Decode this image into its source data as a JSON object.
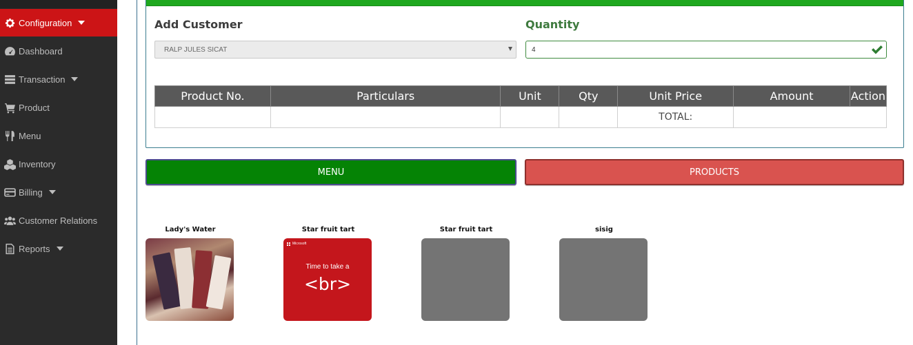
{
  "sidebar": {
    "items": [
      {
        "label": "Configuration",
        "icon": "gear-icon",
        "active": true,
        "has_caret": true
      },
      {
        "label": "Dashboard",
        "icon": "dashboard-icon",
        "active": false,
        "has_caret": false
      },
      {
        "label": "Transaction",
        "icon": "transaction-icon",
        "active": false,
        "has_caret": true
      },
      {
        "label": "Product",
        "icon": "cart-icon",
        "active": false,
        "has_caret": false
      },
      {
        "label": "Menu",
        "icon": "utensils-icon",
        "active": false,
        "has_caret": false
      },
      {
        "label": "Inventory",
        "icon": "cubes-icon",
        "active": false,
        "has_caret": false
      },
      {
        "label": "Billing",
        "icon": "credit-card-icon",
        "active": false,
        "has_caret": true
      },
      {
        "label": "Customer Relations",
        "icon": "users-icon",
        "active": false,
        "has_caret": false
      },
      {
        "label": "Reports",
        "icon": "file-icon",
        "active": false,
        "has_caret": true
      }
    ]
  },
  "form": {
    "customer_label": "Add Customer",
    "customer_value": "RALP JULES SICAT",
    "quantity_label": "Quantity",
    "quantity_value": "4"
  },
  "table": {
    "headers": [
      "Product No.",
      "Particulars",
      "Unit",
      "Qty",
      "Unit Price",
      "Amount",
      "Action"
    ],
    "total_label": "TOTAL:"
  },
  "tabs": {
    "menu_label": "MENU",
    "products_label": "PRODUCTS"
  },
  "tiles": [
    {
      "title": "Lady's Water",
      "image": "photo"
    },
    {
      "title": "Star fruit tart",
      "image": "microsoft-promo",
      "promo_brand": "Microsoft",
      "promo_line1": "Time to take a",
      "promo_line2": "<br>"
    },
    {
      "title": "Star fruit tart",
      "image": "placeholder"
    },
    {
      "title": "sisig",
      "image": "placeholder"
    }
  ],
  "colors": {
    "sidebar_bg": "#2b2b2b",
    "active_item": "#cc1416",
    "panel_topbar": "#1fa81f",
    "menu_button": "#058305",
    "products_button": "#d9534f",
    "table_header": "#595959"
  }
}
